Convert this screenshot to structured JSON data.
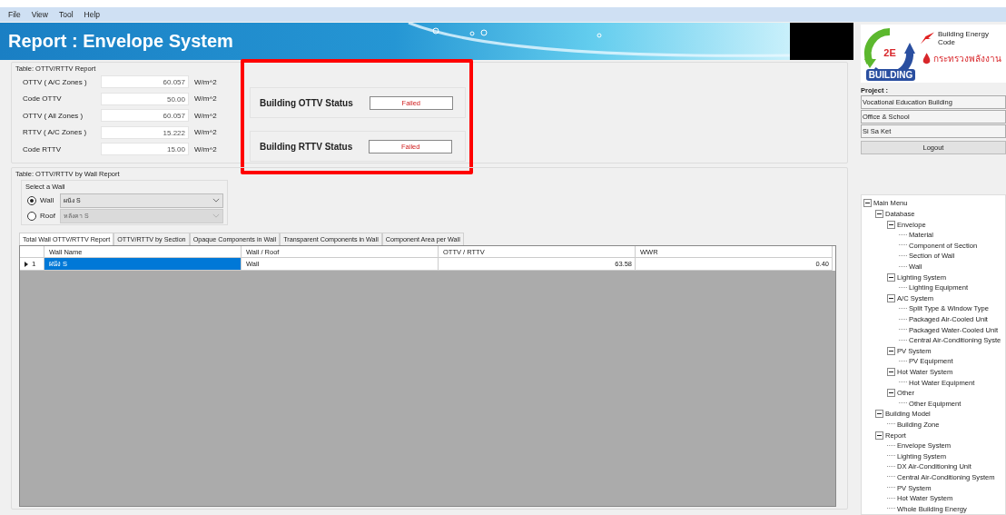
{
  "menu": [
    "File",
    "View",
    "Tool",
    "Help"
  ],
  "banner": {
    "title": "Report : Envelope System"
  },
  "report": {
    "title": "Table: OTTV/RTTV Report",
    "rows": [
      {
        "label": "OTTV ( A/C Zones )",
        "value": "60.057",
        "unit": "W/m^2"
      },
      {
        "label": "Code OTTV",
        "value": "50.00",
        "unit": "W/m^2"
      },
      {
        "label": "OTTV ( All Zones )",
        "value": "60.057",
        "unit": "W/m^2"
      },
      {
        "label": "RTTV ( A/C Zones )",
        "value": "15.222",
        "unit": "W/m^2"
      },
      {
        "label": "Code RTTV",
        "value": "15.00",
        "unit": "W/m^2"
      }
    ],
    "statuses": [
      {
        "label": "Building OTTV Status",
        "value": "Failed"
      },
      {
        "label": "Building RTTV Status",
        "value": "Failed"
      }
    ],
    "highlighted": true
  },
  "wall_report": {
    "title": "Table: OTTV/RTTV by Wall Report",
    "select": {
      "title": "Select a Wall",
      "options": [
        {
          "label": "Wall",
          "selected": true,
          "value": "ผนัง S",
          "disabled": false
        },
        {
          "label": "Roof",
          "selected": false,
          "value": "หลังคา S",
          "disabled": true
        }
      ]
    },
    "tabs": [
      {
        "label": "Total Wall OTTV/RTTV Report",
        "selected": true
      },
      {
        "label": "OTTV/RTTV by Section",
        "selected": false
      },
      {
        "label": "Opaque Components in Wall",
        "selected": false
      },
      {
        "label": "Transparent Components in Wall",
        "selected": false
      },
      {
        "label": "Component Area per Wall",
        "selected": false
      }
    ],
    "table": {
      "columns": [
        "Wall Name",
        "Wall / Roof",
        "OTTV / RTTV",
        "WWR"
      ],
      "rows": [
        {
          "number": "1",
          "current": true,
          "cells": [
            "ผนัง S",
            "Wall",
            "63.58",
            "0.40"
          ],
          "selected": true
        }
      ]
    }
  },
  "logo": {
    "title": "Building Energy Code",
    "badge": "2E",
    "ring": "BUILDING",
    "ministry": "กระทรวงพลังงาน"
  },
  "project": {
    "label": "Project :",
    "fields": [
      "Vocational Education Building",
      "Office & School",
      "Si Sa Ket"
    ],
    "button": "Logout"
  },
  "tree": [
    {
      "label": "Main Menu",
      "expanded": true,
      "children": [
        {
          "label": "Database",
          "expanded": true,
          "children": [
            {
              "label": "Envelope",
              "expanded": true,
              "children": [
                {
                  "label": "Material"
                },
                {
                  "label": "Component of Section"
                },
                {
                  "label": "Section of Wall"
                },
                {
                  "label": "Wall"
                }
              ]
            },
            {
              "label": "Lighting System",
              "expanded": true,
              "children": [
                {
                  "label": "Lighting Equipment"
                }
              ]
            },
            {
              "label": "A/C System",
              "expanded": true,
              "children": [
                {
                  "label": "Split Type & Window Type"
                },
                {
                  "label": "Packaged Air-Cooled Unit"
                },
                {
                  "label": "Packaged Water-Cooled Unit"
                },
                {
                  "label": "Central Air-Conditioning Syste"
                }
              ]
            },
            {
              "label": "PV System",
              "expanded": true,
              "children": [
                {
                  "label": "PV Equipment"
                }
              ]
            },
            {
              "label": "Hot Water System",
              "expanded": true,
              "children": [
                {
                  "label": "Hot Water Equipment"
                }
              ]
            },
            {
              "label": "Other",
              "expanded": true,
              "children": [
                {
                  "label": "Other Equipment"
                }
              ]
            }
          ]
        },
        {
          "label": "Building Model",
          "expanded": true,
          "children": [
            {
              "label": "Building Zone"
            }
          ]
        },
        {
          "label": "Report",
          "expanded": true,
          "children": [
            {
              "label": "Envelope System"
            },
            {
              "label": "Lighting System"
            },
            {
              "label": "DX Air-Conditioning Unit"
            },
            {
              "label": "Central Air-Conditioning System"
            },
            {
              "label": "PV System"
            },
            {
              "label": "Hot Water System"
            },
            {
              "label": "Whole Building Energy"
            }
          ]
        }
      ]
    }
  ]
}
